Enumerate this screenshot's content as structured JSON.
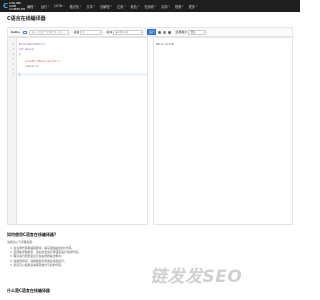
{
  "nav": {
    "logo": {
      "mark": "C",
      "line1": "ONLINE",
      "line2": "GDB COMPILER"
    },
    "items": [
      {
        "label": "编程"
      },
      {
        "label": "运行"
      },
      {
        "label": "JSON"
      },
      {
        "label": "格式化"
      },
      {
        "label": "文本"
      },
      {
        "label": "加解密"
      },
      {
        "label": "正则"
      },
      {
        "label": "颜色"
      },
      {
        "label": "在线看"
      },
      {
        "label": "实用"
      },
      {
        "label": "视频"
      },
      {
        "label": "更多"
      }
    ]
  },
  "page": {
    "title": "C语言在线编译器"
  },
  "toolbar": {
    "hello": "hello,",
    "input_placeholder": "输入: 在这个文本框里，按...",
    "lang_label": "语言",
    "lang_value": "C",
    "version_label": "版本",
    "version_value": "gcc(11.x)",
    "run_label": "运行",
    "theme_label": "结果展示",
    "theme_value": "默认"
  },
  "editor": {
    "corner": "···",
    "lines": [
      "#include\"stdio.h\"",
      "int main()",
      "{",
      "    printf(\"Hello world!\");",
      "    return 0;",
      "}"
    ]
  },
  "output": {
    "corner": "···",
    "text": "Hello world!"
  },
  "article": {
    "heading1": "如何使用C语言在线编译器?",
    "intro": "请通过以下步骤使用:",
    "steps": [
      "1. 在左侧代码框编辑器中，编写或粘贴您的C代码。",
      "2. 选择编译器类型，然后点击运行按钮来运行您的代码。",
      "3. 程序运行结果会显示在右侧的输出框中。",
      "4. 如遇到错误，请根据提示修改后重新运行。",
      "5. 您还可以使用菜单保存或分享您的代码。"
    ],
    "heading2": "什么是C语言在线编译器"
  },
  "watermark": "链发发SEO"
}
